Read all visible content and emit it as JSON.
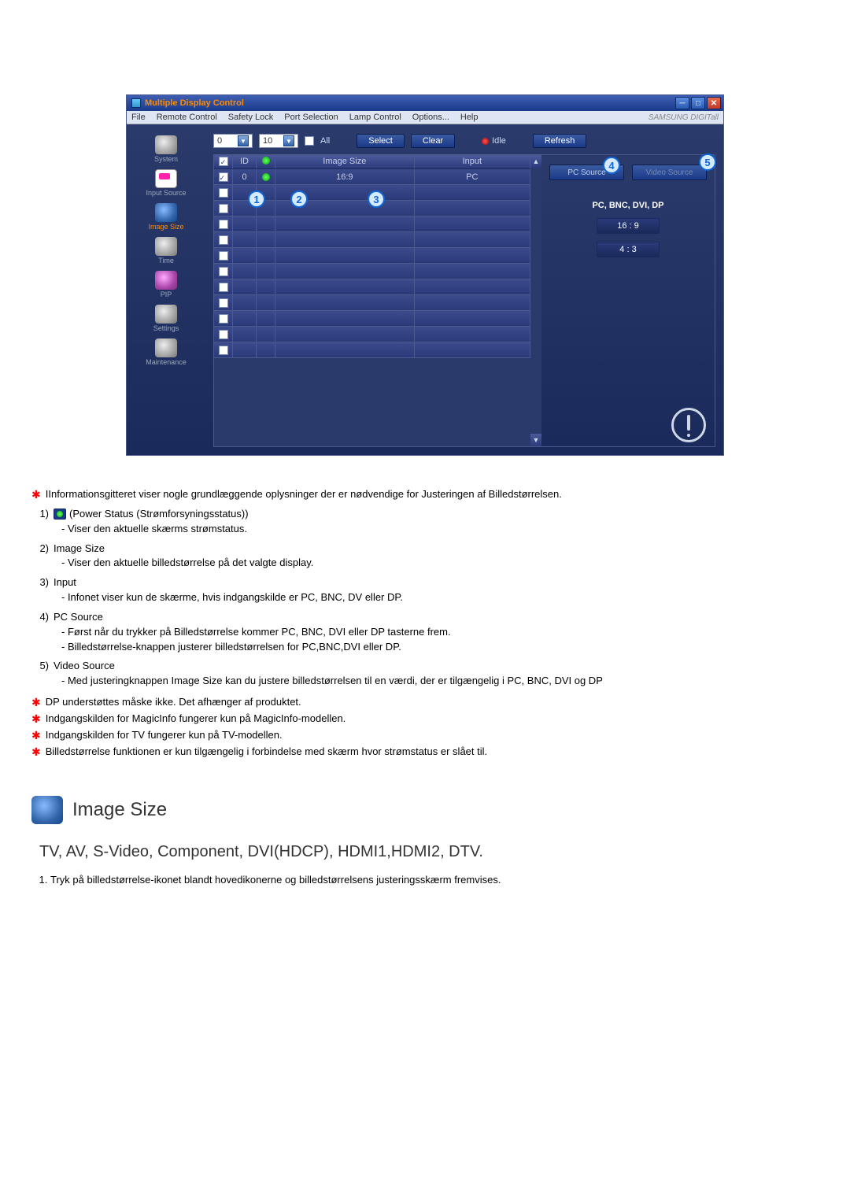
{
  "window": {
    "title": "Multiple Display Control",
    "menu": [
      "File",
      "Remote Control",
      "Safety Lock",
      "Port Selection",
      "Lamp Control",
      "Options...",
      "Help"
    ],
    "brand": "SAMSUNG DIGITall"
  },
  "sidebar": [
    {
      "label": "System",
      "active": false,
      "style": ""
    },
    {
      "label": "Input Source",
      "active": false,
      "style": "tiny-card"
    },
    {
      "label": "Image Size",
      "active": true,
      "style": "blueish"
    },
    {
      "label": "Time",
      "active": false,
      "style": ""
    },
    {
      "label": "PIP",
      "active": false,
      "style": "magenta"
    },
    {
      "label": "Settings",
      "active": false,
      "style": ""
    },
    {
      "label": "Maintenance",
      "active": false,
      "style": ""
    }
  ],
  "toolbar": {
    "dd1": "0",
    "dd2": "10",
    "all": "All",
    "select": "Select",
    "clear": "Clear",
    "idle": "Idle",
    "refresh": "Refresh"
  },
  "grid": {
    "headers": {
      "id": "ID",
      "size": "Image Size",
      "input": "Input"
    },
    "row0": {
      "id": "0",
      "size": "16:9",
      "input": "PC"
    }
  },
  "sourcebar": {
    "pc": "PC Source",
    "video": "Video Source",
    "section": "PC, BNC, DVI, DP",
    "r1": "16 : 9",
    "r2": "4 : 3"
  },
  "callouts": {
    "c1": "1",
    "c2": "2",
    "c3": "3",
    "c4": "4",
    "c5": "5"
  },
  "notes": {
    "top_star": "IInformationsgitteret viser nogle grundlæggende oplysninger der er nødvendige for Justeringen af Billedstørrelsen.",
    "i1_title": "(Power Status (Strømforsyningsstatus))",
    "i1_sub": "- Viser den aktuelle skærms strømstatus.",
    "i2_title": "Image Size",
    "i2_sub": "- Viser den aktuelle billedstørrelse på det valgte display.",
    "i3_title": "Input",
    "i3_sub": "- Infonet viser kun de skærme, hvis indgangskilde er PC, BNC, DV eller DP.",
    "i4_title": "PC Source",
    "i4_sub1": "- Først når du trykker på Billedstørrelse kommer PC, BNC, DVI eller DP tasterne frem.",
    "i4_sub2": "- Billedstørrelse-knappen justerer billedstørrelsen for PC,BNC,DVI eller DP.",
    "i5_title": "Video Source",
    "i5_sub": "- Med justeringknappen Image Size kan du justere billedstørrelsen til en værdi, der er tilgængelig i PC, BNC, DVI og DP",
    "star1": "DP understøttes måske ikke. Det afhænger af produktet.",
    "star2": "Indgangskilden for MagicInfo fungerer kun på MagicInfo-modellen.",
    "star3": "Indgangskilden for TV fungerer kun på TV-modellen.",
    "star4": "Billedstørrelse funktionen er kun tilgængelig i forbindelse med skærm hvor strømstatus er slået til."
  },
  "section": {
    "h1": "Image Size",
    "h2": "TV, AV, S-Video, Component, DVI(HDCP), HDMI1,HDMI2, DTV.",
    "li1": "Tryk på billedstørrelse-ikonet blandt hovedikonerne og billedstørrelsens justeringsskærm fremvises."
  }
}
